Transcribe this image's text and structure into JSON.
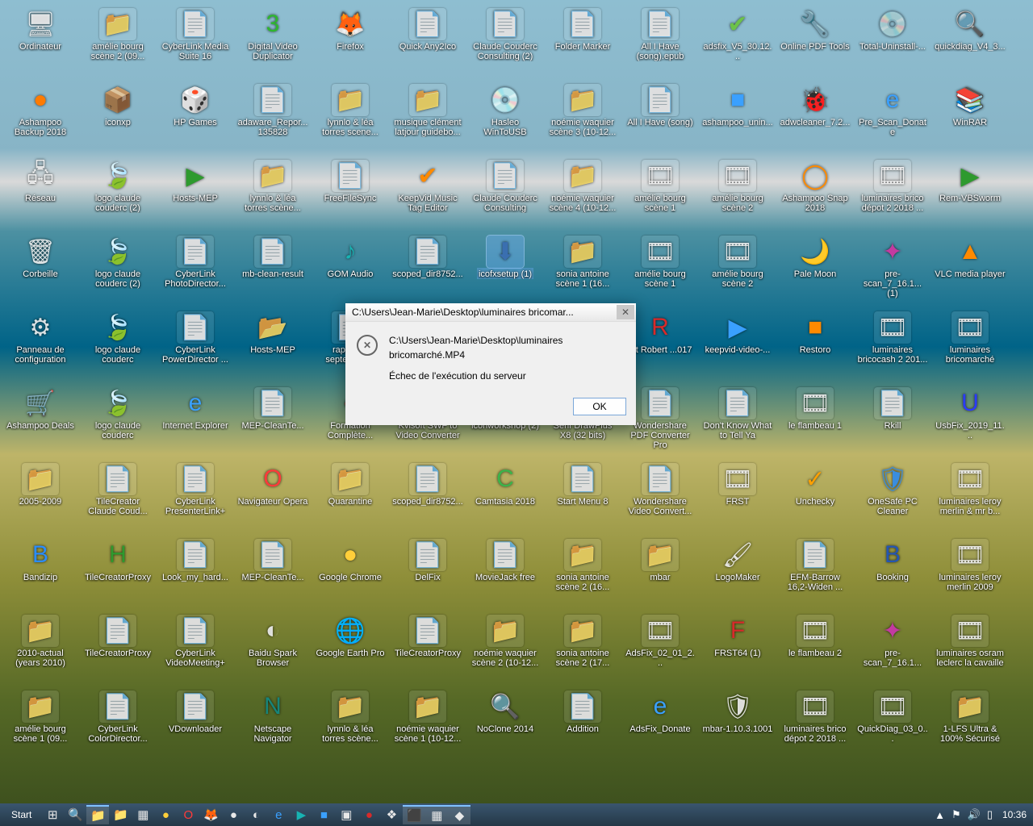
{
  "dialog": {
    "title": "C:\\Users\\Jean-Marie\\Desktop\\luminaires bricomar...",
    "line1": "C:\\Users\\Jean-Marie\\Desktop\\luminaires bricomarché.MP4",
    "line2": "Échec de l'exécution du serveur",
    "ok": "OK"
  },
  "taskbar": {
    "start": "Start",
    "clock": "10:36"
  },
  "icons": [
    {
      "label": "Ordinateur",
      "glyph": "🖥"
    },
    {
      "label": "amélie bourg scène 2 (09...",
      "glyph": "📁"
    },
    {
      "label": "CyberLink Media Suite 16",
      "glyph": "📄"
    },
    {
      "label": "Digital Video Duplicator",
      "glyph": "3",
      "color": "#2db82d"
    },
    {
      "label": "Firefox",
      "glyph": "🦊",
      "color": "#ff7b00"
    },
    {
      "label": "Quick Any2Ico",
      "glyph": "📄"
    },
    {
      "label": "Claude Couderc Consulting (2)",
      "glyph": "📄"
    },
    {
      "label": "Folder Marker",
      "glyph": "📄"
    },
    {
      "label": "All I Have (song).epub",
      "glyph": "📄"
    },
    {
      "label": "adsfix_V5_30.12...",
      "glyph": "✔",
      "color": "#6cc24a"
    },
    {
      "label": "Online PDF Tools",
      "glyph": "🔧"
    },
    {
      "label": "Total-Uninstall-...",
      "glyph": "💿"
    },
    {
      "label": "quickdiag_V4_3...",
      "glyph": "🔍"
    },
    {
      "label": "Ashampoo Backup 2018",
      "glyph": "●",
      "color": "#ff7b00"
    },
    {
      "label": "iconxp",
      "glyph": "📦"
    },
    {
      "label": "HP Games",
      "glyph": "🎲",
      "color": "#ff5a00"
    },
    {
      "label": "adaware_Repor... 135828",
      "glyph": "📄"
    },
    {
      "label": "lynnlo & léa torres scene...",
      "glyph": "📁"
    },
    {
      "label": "musique clément latjour guidebo...",
      "glyph": "📁"
    },
    {
      "label": "Hasleo WinToUSB",
      "glyph": "💿",
      "color": "#3a8dde"
    },
    {
      "label": "noémie waquier scène 3 (10-12...",
      "glyph": "📁"
    },
    {
      "label": "All I Have (song)",
      "glyph": "📄"
    },
    {
      "label": "ashampoo_unin...",
      "glyph": "■",
      "color": "#3aa0ff"
    },
    {
      "label": "adwcleaner_7.2...",
      "glyph": "🐞",
      "color": "#2a3b8f"
    },
    {
      "label": "Pre_Scan_Donate",
      "glyph": "e",
      "color": "#3aa0ff"
    },
    {
      "label": "WinRAR",
      "glyph": "📚",
      "color": "#c64b8c"
    },
    {
      "label": "Réseau",
      "glyph": "🖧"
    },
    {
      "label": "logo claude couderc (2)",
      "glyph": "🍃",
      "color": "#1e5bd8"
    },
    {
      "label": "Hosts-MEP",
      "glyph": "▶",
      "color": "#2e9a2e"
    },
    {
      "label": "lynnlo & léa torres scène...",
      "glyph": "📁"
    },
    {
      "label": "FreeFileSync",
      "glyph": "📄"
    },
    {
      "label": "KeepVid Music Tag Editor",
      "glyph": "✔",
      "color": "#ff8a00"
    },
    {
      "label": "Claude Couderc Consulting",
      "glyph": "📄"
    },
    {
      "label": "noémie waquier scène 4 (10-12...",
      "glyph": "📁"
    },
    {
      "label": "amélie bourg scène 1",
      "glyph": "🎞"
    },
    {
      "label": "amélie bourg scène 2",
      "glyph": "🎞"
    },
    {
      "label": "Ashampoo Snap 2018",
      "glyph": "◯",
      "color": "#ff8a00"
    },
    {
      "label": "luminaires brico dépot 2 2018 ...",
      "glyph": "🎞"
    },
    {
      "label": "Rem-VBSworm",
      "glyph": "▶",
      "color": "#2e9a2e"
    },
    {
      "label": "Corbeille",
      "glyph": "🗑"
    },
    {
      "label": "logo claude couderc (2)",
      "glyph": "🍃",
      "color": "#1e5bd8"
    },
    {
      "label": "CyberLink PhotoDirector...",
      "glyph": "📄"
    },
    {
      "label": "mb-clean-result",
      "glyph": "📄"
    },
    {
      "label": "GOM Audio",
      "glyph": "♪",
      "color": "#17b3b3"
    },
    {
      "label": "scoped_dir8752...",
      "glyph": "📄"
    },
    {
      "label": "icofxsetup (1)",
      "glyph": "⬇",
      "color": "#3a6fb0",
      "selected": true
    },
    {
      "label": "sonia antoine scène 1 (16...",
      "glyph": "📁"
    },
    {
      "label": "amélie bourg scène 1",
      "glyph": "🎞"
    },
    {
      "label": "amélie bourg scène 2",
      "glyph": "🎞"
    },
    {
      "label": "Pale Moon",
      "glyph": "🌙",
      "color": "#3a6fb0"
    },
    {
      "label": "pre-scan_7_16.1... (1)",
      "glyph": "✦",
      "color": "#c33aa0"
    },
    {
      "label": "VLC media player",
      "glyph": "▲",
      "color": "#ff8a00"
    },
    {
      "label": "Panneau de configuration",
      "glyph": "⚙"
    },
    {
      "label": "logo claude couderc",
      "glyph": "🍃",
      "color": "#1e5bd8"
    },
    {
      "label": "CyberLink PowerDirector ...",
      "glyph": "📄"
    },
    {
      "label": "Hosts-MEP",
      "glyph": "📂"
    },
    {
      "label": "rapport... septembre...",
      "glyph": "📄"
    },
    {
      "label": "",
      "glyph": ""
    },
    {
      "label": "",
      "glyph": ""
    },
    {
      "label": "",
      "glyph": ""
    },
    {
      "label": "...t Robert ...017",
      "glyph": "R",
      "color": "#d82a2a"
    },
    {
      "label": "keepvid-video-...",
      "glyph": "▶",
      "color": "#3aa0ff"
    },
    {
      "label": "Restoro",
      "glyph": "■",
      "color": "#ff8a00"
    },
    {
      "label": "luminaires bricocash 2 201...",
      "glyph": "🎞"
    },
    {
      "label": "luminaires bricomarché",
      "glyph": "🎞"
    },
    {
      "label": "Ashampoo Deals",
      "glyph": "🛒",
      "color": "#3a8dde"
    },
    {
      "label": "logo claude couderc",
      "glyph": "🍃",
      "color": "#1e5bd8"
    },
    {
      "label": "Internet Explorer",
      "glyph": "e",
      "color": "#3aa0ff"
    },
    {
      "label": "MEP-CleanTe...",
      "glyph": "📄"
    },
    {
      "label": "Formation Complète...",
      "glyph": "●",
      "color": "#d82a2a"
    },
    {
      "label": "Kvisoft SWF to Video Converter",
      "glyph": "↔"
    },
    {
      "label": "iconworkshop (2)",
      "glyph": "📄"
    },
    {
      "label": "Serif DrawPlus X8 (32 bits)",
      "glyph": "📄"
    },
    {
      "label": "Wondershare PDF Converter Pro",
      "glyph": "📄"
    },
    {
      "label": "Don't Know What to Tell Ya",
      "glyph": "📄"
    },
    {
      "label": "le flambeau 1",
      "glyph": "🎞"
    },
    {
      "label": "Rkill",
      "glyph": "📄"
    },
    {
      "label": "UsbFix_2019_11...",
      "glyph": "U",
      "color": "#2a3bff"
    },
    {
      "label": "2005-2009",
      "glyph": "📁"
    },
    {
      "label": "TileCreator Claude Coud...",
      "glyph": "📄"
    },
    {
      "label": "CyberLink PresenterLink+",
      "glyph": "📄"
    },
    {
      "label": "Navigateur Opera",
      "glyph": "O",
      "color": "#ff3a3a"
    },
    {
      "label": "Quarantine",
      "glyph": "📁"
    },
    {
      "label": "scoped_dir8752...",
      "glyph": "📄"
    },
    {
      "label": "Camtasia 2018",
      "glyph": "C",
      "color": "#3bb44a"
    },
    {
      "label": "Start Menu 8",
      "glyph": "📄"
    },
    {
      "label": "Wondershare Video Convert...",
      "glyph": "📄"
    },
    {
      "label": "FRST",
      "glyph": "🎞"
    },
    {
      "label": "Unchecky",
      "glyph": "✓",
      "color": "#ffa000"
    },
    {
      "label": "OneSafe PC Cleaner",
      "glyph": "🛡",
      "color": "#3a8dde"
    },
    {
      "label": "luminaires leroy merlin & mr b...",
      "glyph": "🎞"
    },
    {
      "label": "Bandizip",
      "glyph": "B",
      "color": "#2a8dff"
    },
    {
      "label": "TileCreatorProxy",
      "glyph": "H",
      "color": "#2e9a2e"
    },
    {
      "label": "Look_my_hard...",
      "glyph": "📄"
    },
    {
      "label": "MEP-CleanTe...",
      "glyph": "📄"
    },
    {
      "label": "Google Chrome",
      "glyph": "●",
      "color": "#ffcf3a"
    },
    {
      "label": "DelFix",
      "glyph": "📄"
    },
    {
      "label": "MovieJack free",
      "glyph": "📄"
    },
    {
      "label": "sonia antoine scène 2 (16...",
      "glyph": "📁"
    },
    {
      "label": "mbar",
      "glyph": "📁"
    },
    {
      "label": "LogoMaker",
      "glyph": "🖌"
    },
    {
      "label": "EFM-Barrow 16,2-Widen ...",
      "glyph": "📄"
    },
    {
      "label": "Booking",
      "glyph": "B",
      "color": "#2456b3"
    },
    {
      "label": "luminaires leroy merlin 2009",
      "glyph": "🎞"
    },
    {
      "label": "2010-actual (years 2010)",
      "glyph": "📁"
    },
    {
      "label": "TileCreatorProxy",
      "glyph": "📄"
    },
    {
      "label": "CyberLink VideoMeeting+",
      "glyph": "📄"
    },
    {
      "label": "Baidu Spark Browser",
      "glyph": "◐"
    },
    {
      "label": "Google Earth Pro",
      "glyph": "🌐",
      "color": "#3a8dde"
    },
    {
      "label": "TileCreatorProxy",
      "glyph": "📄"
    },
    {
      "label": "noémie waquier scène 2 (10-12...",
      "glyph": "📁"
    },
    {
      "label": "sonia antoine scène 2 (17...",
      "glyph": "📁"
    },
    {
      "label": "AdsFix_02_01_2...",
      "glyph": "🎞"
    },
    {
      "label": "FRST64 (1)",
      "glyph": "F",
      "color": "#d82a2a"
    },
    {
      "label": "le flambeau 2",
      "glyph": "🎞"
    },
    {
      "label": "pre-scan_7_16.1...",
      "glyph": "✦",
      "color": "#c33aa0"
    },
    {
      "label": "luminaires osram leclerc la cavaille",
      "glyph": "🎞"
    },
    {
      "label": "amélie bourg scène 1 (09...",
      "glyph": "📁"
    },
    {
      "label": "CyberLink ColorDirector...",
      "glyph": "📄"
    },
    {
      "label": "VDownloader",
      "glyph": "📄"
    },
    {
      "label": "Netscape Navigator",
      "glyph": "N",
      "color": "#17857a"
    },
    {
      "label": "lynnlo & léa torres scène...",
      "glyph": "📁"
    },
    {
      "label": "noémie waquier scène 1 (10-12...",
      "glyph": "📁"
    },
    {
      "label": "NoClone 2014",
      "glyph": "🔍",
      "color": "#3aa0ff"
    },
    {
      "label": "Addition",
      "glyph": "📄"
    },
    {
      "label": "AdsFix_Donate",
      "glyph": "e",
      "color": "#3aa0ff"
    },
    {
      "label": "mbar-1.10.3.1001",
      "glyph": "🛡"
    },
    {
      "label": "luminaires brico dépot 2 2018 ...",
      "glyph": "🎞"
    },
    {
      "label": "QuickDiag_03_0...",
      "glyph": "🎞"
    },
    {
      "label": "1-LFS Ultra & 100% Sécurisé",
      "glyph": "📁"
    }
  ],
  "taskbar_items": [
    {
      "glyph": "⊞",
      "name": "start-menu-icon"
    },
    {
      "glyph": "🔍",
      "name": "search-icon"
    },
    {
      "glyph": "📁",
      "name": "file-explorer-icon",
      "active": true
    },
    {
      "glyph": "📁",
      "name": "folder-icon"
    },
    {
      "glyph": "▦",
      "name": "app-icon"
    },
    {
      "glyph": "●",
      "name": "chrome-icon",
      "color": "#ffcf3a"
    },
    {
      "glyph": "O",
      "name": "opera-icon",
      "color": "#ff3a3a"
    },
    {
      "glyph": "🦊",
      "name": "firefox-icon",
      "color": "#ff7b00"
    },
    {
      "glyph": "●",
      "name": "app2-icon"
    },
    {
      "glyph": "◐",
      "name": "baidu-icon"
    },
    {
      "glyph": "e",
      "name": "ie-icon",
      "color": "#3aa0ff"
    },
    {
      "glyph": "▶",
      "name": "media-icon",
      "color": "#17b3b3"
    },
    {
      "glyph": "■",
      "name": "app3-icon",
      "color": "#3aa0ff"
    },
    {
      "glyph": "▣",
      "name": "app4-icon"
    },
    {
      "glyph": "●",
      "name": "app5-icon",
      "color": "#d82a2a"
    },
    {
      "glyph": "❖",
      "name": "app6-icon"
    },
    {
      "glyph": "⬛",
      "name": "app7-icon",
      "active": true
    },
    {
      "glyph": "▦",
      "name": "app8-icon",
      "active": true
    },
    {
      "glyph": "◆",
      "name": "app9-icon",
      "active": true
    }
  ],
  "tray": [
    {
      "glyph": "▲",
      "name": "tray-overflow-icon"
    },
    {
      "glyph": "⚑",
      "name": "action-center-icon"
    },
    {
      "glyph": "🔊",
      "name": "volume-icon"
    },
    {
      "glyph": "▯",
      "name": "network-icon"
    }
  ]
}
